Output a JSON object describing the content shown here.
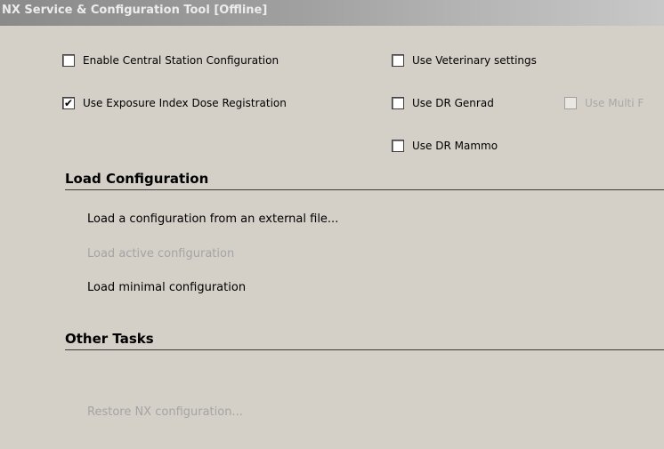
{
  "window": {
    "title": "NX Service & Configuration Tool [Offline]"
  },
  "options": {
    "central_station": {
      "label": "Enable Central Station Configuration",
      "checked": false,
      "enabled": true
    },
    "exposure_index": {
      "label": "Use Exposure Index Dose Registration",
      "checked": true,
      "enabled": true,
      "mark": "✔"
    },
    "veterinary": {
      "label": "Use Veterinary settings",
      "checked": false,
      "enabled": true
    },
    "dr_genrad": {
      "label": "Use DR Genrad",
      "checked": false,
      "enabled": true
    },
    "dr_mammo": {
      "label": "Use DR Mammo",
      "checked": false,
      "enabled": true
    },
    "multi": {
      "label": "Use Multi F",
      "checked": false,
      "enabled": false
    }
  },
  "load_configuration": {
    "header": "Load Configuration",
    "items": [
      {
        "label": "Load a configuration from an external file...",
        "enabled": true
      },
      {
        "label": "Load active configuration",
        "enabled": false
      },
      {
        "label": "Load minimal configuration",
        "enabled": true
      }
    ]
  },
  "other_tasks": {
    "header": "Other Tasks",
    "items": [
      {
        "label": "Restore NX configuration...",
        "enabled": false
      }
    ]
  }
}
